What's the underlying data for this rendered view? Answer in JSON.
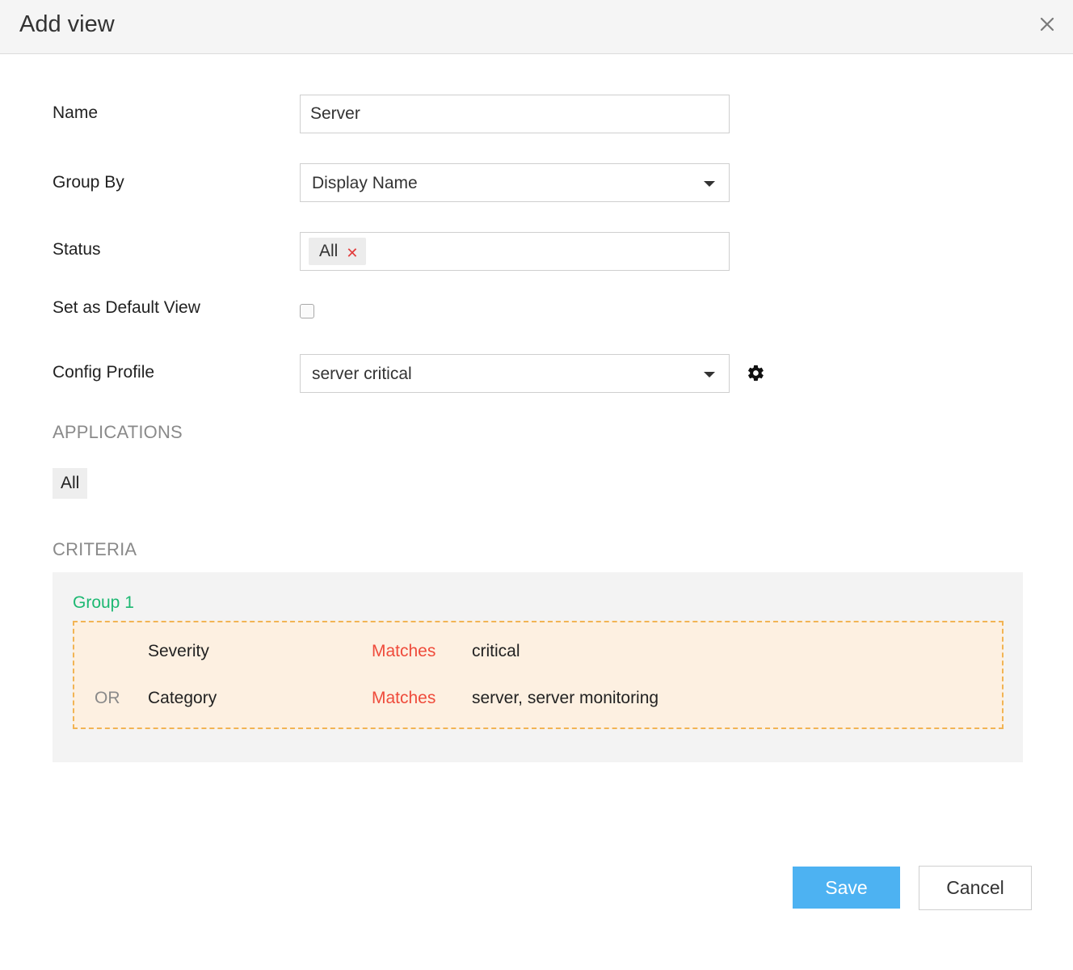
{
  "dialog": {
    "title": "Add view",
    "close_icon": "close-icon"
  },
  "form": {
    "name": {
      "label": "Name",
      "value": "Server"
    },
    "group_by": {
      "label": "Group By",
      "value": "Display Name"
    },
    "status": {
      "label": "Status",
      "tags": [
        "All"
      ]
    },
    "default_view": {
      "label": "Set as Default View",
      "checked": false
    },
    "config_profile": {
      "label": "Config Profile",
      "value": "server critical",
      "settings_icon": "gear-icon"
    }
  },
  "applications": {
    "heading": "APPLICATIONS",
    "items": [
      "All"
    ]
  },
  "criteria": {
    "heading": "CRITERIA",
    "groups": [
      {
        "title": "Group 1",
        "rows": [
          {
            "operator": "",
            "field": "Severity",
            "condition": "Matches",
            "value": "critical"
          },
          {
            "operator": "OR",
            "field": "Category",
            "condition": "Matches",
            "value": "server, server monitoring"
          }
        ]
      }
    ]
  },
  "actions": {
    "save_label": "Save",
    "cancel_label": "Cancel"
  },
  "colors": {
    "accent": "#4db2f2",
    "group_title": "#1db872",
    "condition": "#ef4b3b",
    "tag_remove": "#e23b3b",
    "group_border": "#f2b454",
    "group_bg": "#fdf0e1"
  }
}
